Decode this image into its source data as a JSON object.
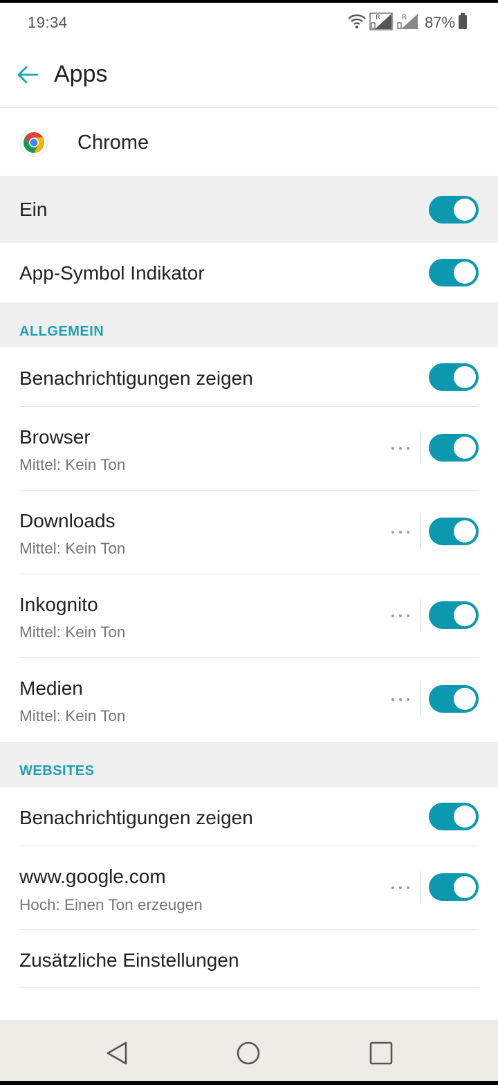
{
  "status_bar": {
    "time": "19:34",
    "battery_percent": "87%",
    "icons": [
      "wifi-icon",
      "signal-roaming-icon",
      "signal-roaming-icon",
      "battery-icon"
    ],
    "roaming_indicator": "R"
  },
  "header": {
    "title": "Apps",
    "back_icon": "arrow-left-icon"
  },
  "app": {
    "name": "Chrome",
    "icon": "chrome-logo-icon"
  },
  "master_toggle": {
    "label": "Ein",
    "on": true
  },
  "app_badge": {
    "label": "App-Symbol Indikator",
    "on": true
  },
  "sections": [
    {
      "header": "ALLGEMEIN",
      "items": [
        {
          "title": "Benachrichtigungen zeigen",
          "subtitle": "",
          "on": true
        },
        {
          "title": "Browser",
          "subtitle": "Mittel: Kein Ton",
          "on": true
        },
        {
          "title": "Downloads",
          "subtitle": "Mittel: Kein Ton",
          "on": true
        },
        {
          "title": "Inkognito",
          "subtitle": "Mittel: Kein Ton",
          "on": true
        },
        {
          "title": "Medien",
          "subtitle": "Mittel: Kein Ton",
          "on": true
        }
      ]
    },
    {
      "header": "WEBSITES",
      "items": [
        {
          "title": "Benachrichtigungen zeigen",
          "subtitle": "",
          "on": true
        },
        {
          "title": "www.google.com",
          "subtitle": "Hoch: Einen Ton erzeugen",
          "on": true
        },
        {
          "title": "Zusätzliche Einstellungen",
          "subtitle": ""
        }
      ]
    }
  ],
  "nav_bar": {
    "icons": [
      "back-triangle-icon",
      "home-circle-icon",
      "recents-square-icon"
    ]
  },
  "colors": {
    "accent": "#0c98ae",
    "section_header_text": "#1e9fb5",
    "section_background": "#efefef",
    "nav_background": "#eeebe7"
  }
}
